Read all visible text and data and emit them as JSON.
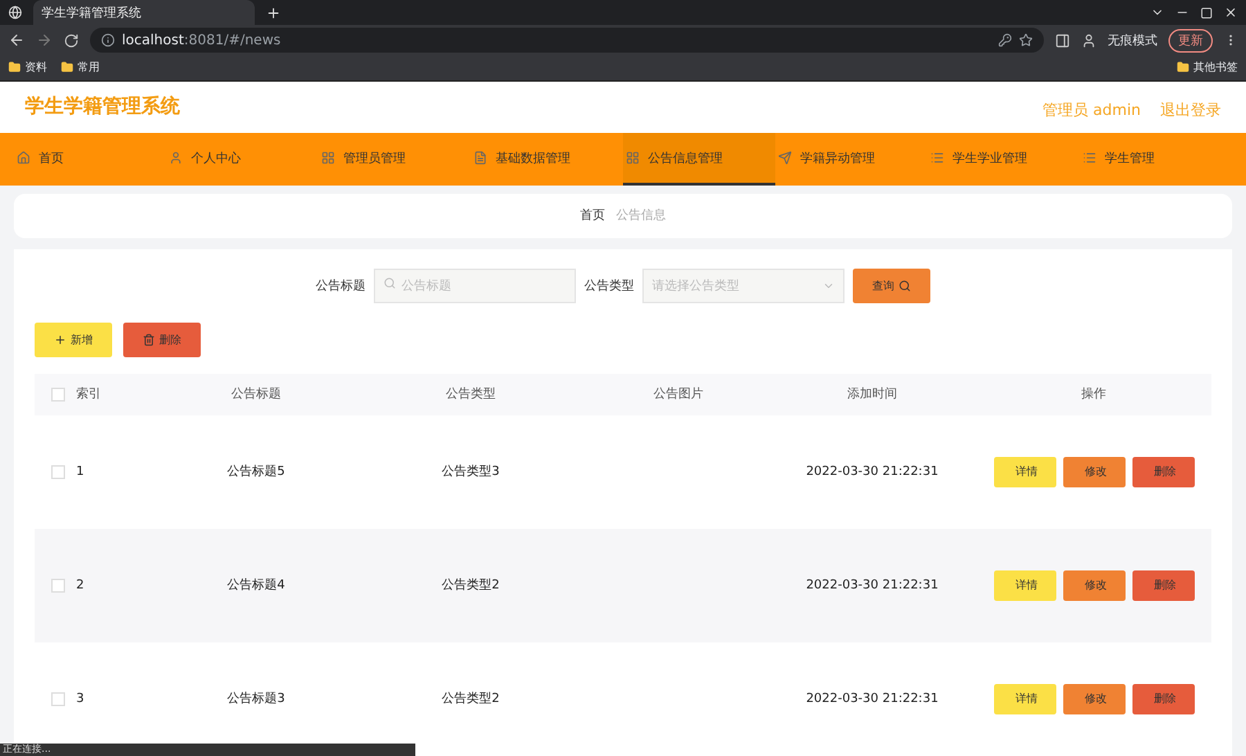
{
  "browser": {
    "tab_title": "学生学籍管理系统",
    "url_host": "localhost",
    "url_rest": ":8081/#/news",
    "profile": "无痕模式",
    "update": "更新",
    "bookmarks": [
      "资料",
      "常用"
    ],
    "other_bookmarks": "其他书签",
    "status": "正在连接..."
  },
  "header": {
    "title": "学生学籍管理系统",
    "user": "管理员 admin",
    "logout": "退出登录"
  },
  "nav": [
    {
      "label": "首页",
      "selected": false
    },
    {
      "label": "个人中心",
      "selected": false
    },
    {
      "label": "管理员管理",
      "selected": false
    },
    {
      "label": "基础数据管理",
      "selected": false
    },
    {
      "label": "公告信息管理",
      "selected": true
    },
    {
      "label": "学籍异动管理",
      "selected": false
    },
    {
      "label": "学生学业管理",
      "selected": false
    },
    {
      "label": "学生管理",
      "selected": false
    }
  ],
  "breadcrumb": [
    "首页",
    "公告信息"
  ],
  "search": {
    "title_label": "公告标题",
    "title_placeholder": "公告标题",
    "type_label": "公告类型",
    "type_placeholder": "请选择公告类型",
    "button": "查询"
  },
  "actions": {
    "add": "新增",
    "delete": "删除"
  },
  "table": {
    "all_checked": false,
    "columns": [
      "索引",
      "公告标题",
      "公告类型",
      "公告图片",
      "添加时间",
      "操作"
    ],
    "rows": [
      {
        "checked": false,
        "index": "1",
        "title": "公告标题5",
        "type": "公告类型3",
        "time": "2022-03-30 21:22:31",
        "buttons": [
          "详情",
          "修改",
          "删除"
        ]
      },
      {
        "checked": false,
        "index": "2",
        "title": "公告标题4",
        "type": "公告类型2",
        "time": "2022-03-30 21:22:31",
        "buttons": [
          "详情",
          "修改",
          "删除"
        ]
      },
      {
        "checked": false,
        "index": "3",
        "title": "公告标题3",
        "type": "公告类型2",
        "time": "2022-03-30 21:22:31",
        "buttons": [
          "详情",
          "修改",
          "删除"
        ]
      }
    ]
  }
}
